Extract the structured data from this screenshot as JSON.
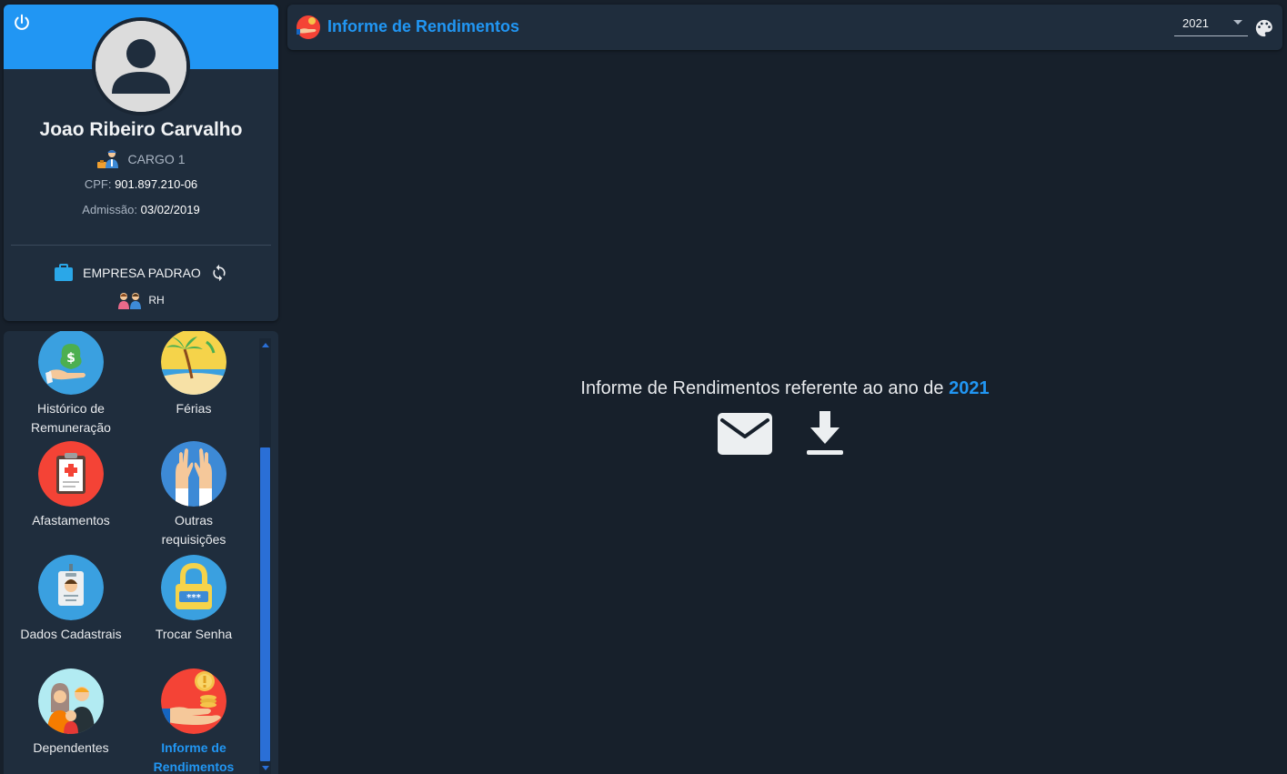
{
  "profile": {
    "name": "Joao Ribeiro Carvalho",
    "cargo": "CARGO 1",
    "cpf_label": "CPF:",
    "cpf_value": "901.897.210-06",
    "admissao_label": "Admissão:",
    "admissao_value": "03/02/2019",
    "empresa": "EMPRESA PADRAO",
    "departamento": "RH",
    "icons": [
      "power-icon",
      "avatar-icon",
      "worker-icon",
      "briefcase-icon",
      "sync-icon",
      "team-icon"
    ]
  },
  "menu": {
    "items": [
      {
        "label_line1": "Histórico de",
        "label_line2": "Remuneração",
        "icon": "money-bag-icon"
      },
      {
        "label_line1": "Férias",
        "label_line2": "",
        "icon": "beach-icon"
      },
      {
        "label_line1": "Afastamentos",
        "label_line2": "",
        "icon": "medical-clipboard-icon"
      },
      {
        "label_line1": "Outras",
        "label_line2": "requisições",
        "icon": "raised-hands-icon"
      },
      {
        "label_line1": "Dados Cadastrais",
        "label_line2": "",
        "icon": "id-badge-icon"
      },
      {
        "label_line1": "Trocar Senha",
        "label_line2": "",
        "icon": "padlock-icon"
      },
      {
        "label_line1": "Dependentes",
        "label_line2": "",
        "icon": "family-icon"
      },
      {
        "label_line1": "Informe de",
        "label_line2": "Rendimentos",
        "icon": "income-hand-icon",
        "active": true
      }
    ]
  },
  "topbar": {
    "title": "Informe de Rendimentos",
    "year_selected": "2021",
    "icons": [
      "income-icon",
      "palette-icon"
    ]
  },
  "main": {
    "message": "Informe de Rendimentos referente ao ano de",
    "year": "2021",
    "actions": [
      "email-icon",
      "download-icon"
    ]
  },
  "colors": {
    "accent": "#2196f3",
    "background": "#17202b",
    "card": "#1f2d3d",
    "scrollbar": "#2a6fd6"
  }
}
